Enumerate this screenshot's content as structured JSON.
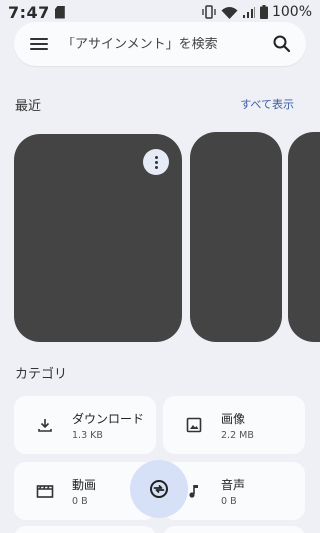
{
  "status": {
    "time": "7:47",
    "battery": "100%"
  },
  "search": {
    "placeholder": "「アサインメント」を検索"
  },
  "recent": {
    "title": "最近",
    "see_all": "すべて表示"
  },
  "categories": {
    "title": "カテゴリ",
    "items": [
      {
        "name": "ダウンロード",
        "size": "1.3 KB"
      },
      {
        "name": "画像",
        "size": "2.2 MB"
      },
      {
        "name": "動画",
        "size": "0 B"
      },
      {
        "name": "音声",
        "size": "0 B"
      }
    ]
  }
}
